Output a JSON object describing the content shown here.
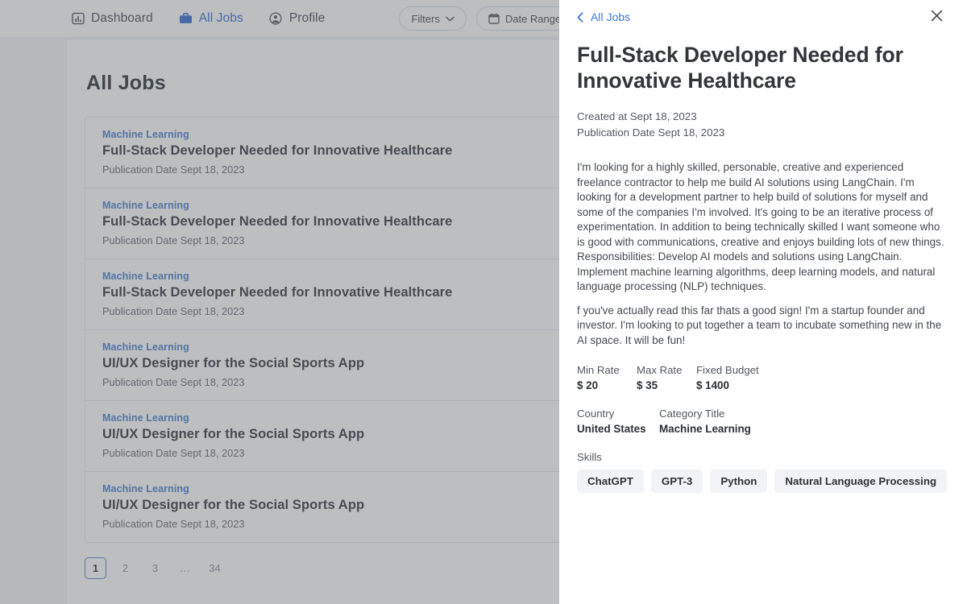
{
  "nav": {
    "items": [
      {
        "label": "Dashboard",
        "icon": "chart-bar-icon",
        "active": false
      },
      {
        "label": "All Jobs",
        "icon": "briefcase-icon",
        "active": true
      },
      {
        "label": "Profile",
        "icon": "user-circle-icon",
        "active": false
      }
    ],
    "toolbar": [
      {
        "label": "Filters",
        "icon": "chevron-down-icon"
      },
      {
        "label": "Date Range",
        "icon": "calendar-icon"
      },
      {
        "label": "",
        "icon": "clock-icon"
      }
    ]
  },
  "page": {
    "title": "All Jobs",
    "jobs": [
      {
        "category": "Machine Learning",
        "title": "Full-Stack Developer Needed for Innovative Healthcare",
        "date": "Publication Date Sept 18, 2023"
      },
      {
        "category": "Machine Learning",
        "title": "Full-Stack Developer Needed for Innovative Healthcare",
        "date": "Publication Date Sept 18, 2023"
      },
      {
        "category": "Machine Learning",
        "title": "Full-Stack Developer Needed for Innovative Healthcare",
        "date": "Publication Date Sept 18, 2023"
      },
      {
        "category": "Machine Learning",
        "title": "UI/UX Designer for the Social Sports App",
        "date": "Publication Date Sept 18, 2023"
      },
      {
        "category": "Machine Learning",
        "title": "UI/UX Designer for the Social Sports App",
        "date": "Publication Date Sept 18, 2023"
      },
      {
        "category": "Machine Learning",
        "title": "UI/UX Designer for the Social Sports App",
        "date": "Publication Date Sept 18, 2023"
      }
    ],
    "pagination": {
      "pages": [
        "1",
        "2",
        "3",
        "…",
        "34"
      ],
      "current": "1"
    }
  },
  "drawer": {
    "back_label": "All Jobs",
    "close_label": "×",
    "title": "Full-Stack Developer Needed for Innovative Healthcare",
    "created_at": "Created at Sept 18, 2023",
    "publication_date": "Publication Date Sept 18, 2023",
    "description": [
      "I'm looking for a highly skilled, personable, creative and experienced freelance contractor to help me build AI solutions using LangChain. I'm looking for a development partner to help build of solutions for myself and some of the companies I'm involved. It's going to be an iterative process of experimentation. In addition to being technically skilled I want someone who is good with communications, creative and enjoys building lots of new things. Responsibilities: Develop AI models and solutions using LangChain. Implement machine learning algorithms, deep learning models, and natural language processing (NLP) techniques.",
      "f you've actually read this far thats a good sign! I'm a startup founder and investor. I'm looking to put together a team to incubate something new in the AI space. It will be fun!"
    ],
    "rates": [
      {
        "label": "Min Rate",
        "value": "$ 20"
      },
      {
        "label": "Max Rate",
        "value": "$ 35"
      },
      {
        "label": "Fixed Budget",
        "value": "$ 1400"
      }
    ],
    "attributes": [
      {
        "label": "Country",
        "value": "United States"
      },
      {
        "label": "Category Title",
        "value": "Machine Learning"
      }
    ],
    "skills_label": "Skills",
    "skills": [
      "ChatGPT",
      "GPT-3",
      "Python",
      "Natural Language Processing"
    ]
  },
  "colors": {
    "accent_blue": "#3c74dd",
    "category_blue": "#4e82cd",
    "text_dark": "#31353b",
    "chip_bg": "#f1f3f6"
  }
}
